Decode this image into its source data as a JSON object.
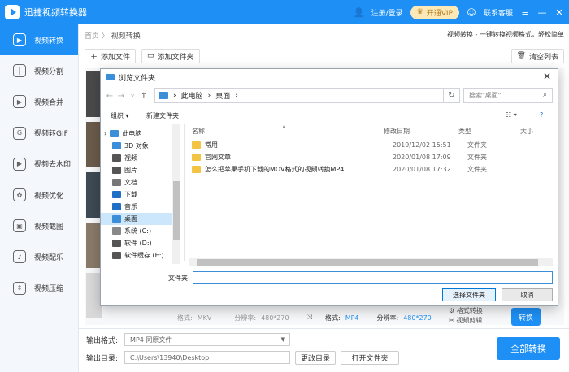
{
  "app": {
    "title": "迅捷视频转换器"
  },
  "header": {
    "login": "注册/登录",
    "vip": "开通VIP",
    "support": "联系客服"
  },
  "sidebar": {
    "items": [
      {
        "label": "视频转换",
        "icon": "convert-icon",
        "active": true
      },
      {
        "label": "视频分割",
        "icon": "split-icon"
      },
      {
        "label": "视频合并",
        "icon": "merge-icon"
      },
      {
        "label": "视频转GIF",
        "icon": "gif-icon"
      },
      {
        "label": "视频去水印",
        "icon": "watermark-icon"
      },
      {
        "label": "视频优化",
        "icon": "optimize-icon"
      },
      {
        "label": "视频截图",
        "icon": "screenshot-icon"
      },
      {
        "label": "视频配乐",
        "icon": "music-icon"
      },
      {
        "label": "视频压缩",
        "icon": "compress-icon"
      }
    ]
  },
  "breadcrumb": {
    "home": "首页",
    "sep": "〉",
    "current": "视频转换",
    "hint": "视频转换 - 一键转换视频格式，轻松简单"
  },
  "toolbar": {
    "add_file": "添加文件",
    "add_folder": "添加文件夹",
    "clear": "清空列表"
  },
  "file_meta": {
    "format_label": "格式:",
    "format_src": "MKV",
    "res_label": "分辨率:",
    "res_src": "480*270",
    "format_dst": "MP4",
    "res_dst": "480*270",
    "format_settings": "格式转换",
    "video_crop": "视频剪辑",
    "convert": "转换"
  },
  "bottom": {
    "output_format_label": "输出格式:",
    "output_format_value": "MP4   同原文件",
    "output_dir_label": "输出目录:",
    "output_dir_value": "C:\\Users\\13940\\Desktop",
    "change_dir": "更改目录",
    "open_folder": "打开文件夹",
    "convert_all": "全部转换"
  },
  "dialog": {
    "title": "浏览文件夹",
    "address": [
      "此电脑",
      "桌面"
    ],
    "search_placeholder": "搜索\"桌面\"",
    "organize": "组织",
    "new_folder": "新建文件夹",
    "columns": {
      "name": "名称",
      "modified": "修改日期",
      "type": "类型",
      "size": "大小"
    },
    "nav": [
      {
        "label": "此电脑",
        "color": "#3b8fd9"
      },
      {
        "label": "3D 对象",
        "color": "#3b8fd9"
      },
      {
        "label": "视频",
        "color": "#555"
      },
      {
        "label": "图片",
        "color": "#555"
      },
      {
        "label": "文档",
        "color": "#777"
      },
      {
        "label": "下载",
        "color": "#1e6fc5"
      },
      {
        "label": "音乐",
        "color": "#1e6fc5"
      },
      {
        "label": "桌面",
        "color": "#3b8fd9",
        "selected": true
      },
      {
        "label": "系统 (C:)",
        "color": "#888"
      },
      {
        "label": "软件 (D:)",
        "color": "#555"
      },
      {
        "label": "软件缓存 (E:)",
        "color": "#555"
      }
    ],
    "files": [
      {
        "name": "常用",
        "date": "2019/12/02 15:51",
        "type": "文件夹"
      },
      {
        "name": "官网文章",
        "date": "2020/01/08 17:09",
        "type": "文件夹"
      },
      {
        "name": "怎么把苹果手机下载的MOV格式的视频转换MP4",
        "date": "2020/01/08 17:32",
        "type": "文件夹"
      }
    ],
    "filename_label": "文件夹:",
    "select_button": "选择文件夹",
    "cancel_button": "取消"
  }
}
